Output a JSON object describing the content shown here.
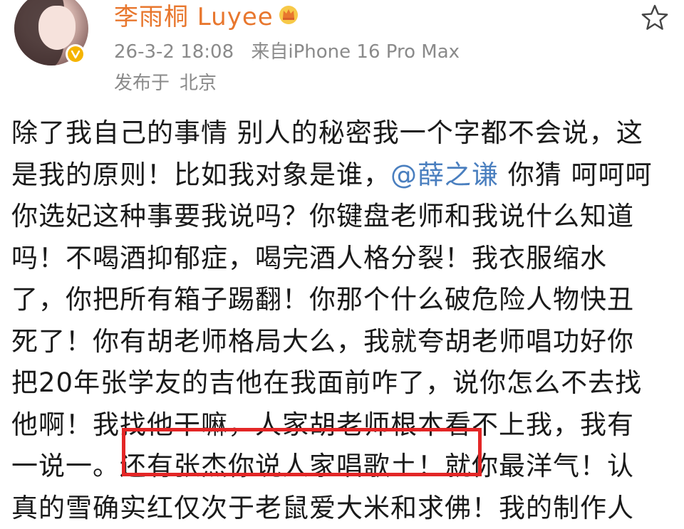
{
  "post": {
    "author": {
      "name": "李雨桐 Luyee"
    },
    "meta": {
      "date": "26-3-2 18:08",
      "source": "来自iPhone 16 Pro Max"
    },
    "location": {
      "label": "发布于",
      "city": "北京"
    },
    "body": {
      "line1": "除了我自己的事情 别人的秘密我一个字都不会说，这",
      "line2_pre": "是我的原则！比如我对象是谁，",
      "mention": "@薛之谦",
      "line2_post": " 你猜 呵呵呵",
      "line3": "你选妃这种事要我说吗？你键盘老师和我说什么知道",
      "line4": "吗！不喝酒抑郁症，喝完酒人格分裂！我衣服缩水",
      "line5": "了，你把所有箱子踢翻！你那个什么破危险人物快丑",
      "line6": "死了！你有胡老师格局大么，我就夸胡老师唱功好你",
      "line7": "把20年张学友的吉他在我面前咋了，说你怎么不去找",
      "line8": "他啊！我找他干嘛，人家胡老师根本看不上我，我有",
      "line9": "一说一。还有张杰你说人家唱歌土！就你最洋气！认",
      "line10": "真的雪确实红仅次于老鼠爱大米和求佛！我的制作人"
    }
  },
  "icons": {
    "avatar": "avatar",
    "verified": "verified-badge-icon",
    "vip": "crown-icon",
    "favorite": "star-icon"
  },
  "colors": {
    "username": "#e8772e",
    "meta": "#8a8a8a",
    "mention": "#4a7fbf",
    "highlight": "#e32626",
    "badge": "#f5b400"
  }
}
